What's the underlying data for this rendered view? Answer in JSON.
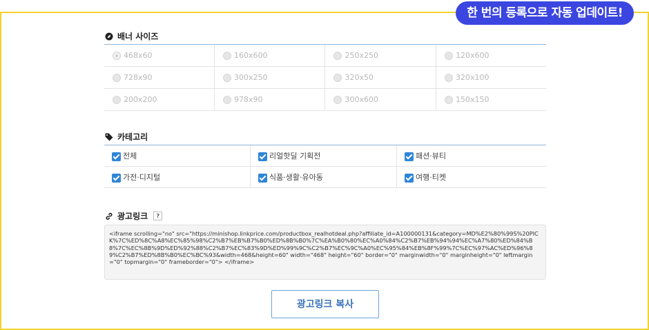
{
  "promo_badge": "한 번의 등록으로 자동 업데이트!",
  "banner_size": {
    "title": "배너 사이즈",
    "selected": "468x60",
    "rows": [
      [
        "468x60",
        "160x600",
        "250x250",
        "120x600"
      ],
      [
        "728x90",
        "300x250",
        "320x50",
        "320x100"
      ],
      [
        "200x200",
        "978x90",
        "300x600",
        "150x150"
      ]
    ]
  },
  "category": {
    "title": "카테고리",
    "rows": [
      [
        "전체",
        "리얼핫딜 기획전",
        "패션·뷰티"
      ],
      [
        "가전·디지털",
        "식품·생활·유아동",
        "여행·티켓"
      ]
    ]
  },
  "ad_link": {
    "title": "광고링크",
    "help": "?",
    "code": "<iframe scrolling=\"no\" src=\"https://minishop.linkprice.com/productbox_realhotdeal.php?affiliate_id=A100000131&category=MD%E2%80%99S%20PICK%7C%ED%8C%A8%EC%85%98%C2%B7%EB%B7%B0%ED%8B%B0%7C%EA%B0%80%EC%A0%84%C2%B7%EB%94%94%EC%A7%80%ED%84%B8%7C%EC%8B%9D%ED%92%88%C2%B7%EC%83%9D%ED%99%9C%C2%B7%EC%9C%A0%EC%95%84%EB%8F%99%7C%EC%97%AC%ED%96%89%C2%B7%ED%8B%B0%EC%BC%93&width=468&height=60\" width=\"468\" height=\"60\" border=\"0\" marginwidth=\"0\" marginheight=\"0\" leftmargin=\"0\" topmargin=\"0\" frameborder=\"0\"> </iframe>",
    "copy_button": "광고링크 복사"
  },
  "colors": {
    "frame": "#f5d12b",
    "badge": "#3b45e0",
    "accent": "#2f86d6"
  }
}
